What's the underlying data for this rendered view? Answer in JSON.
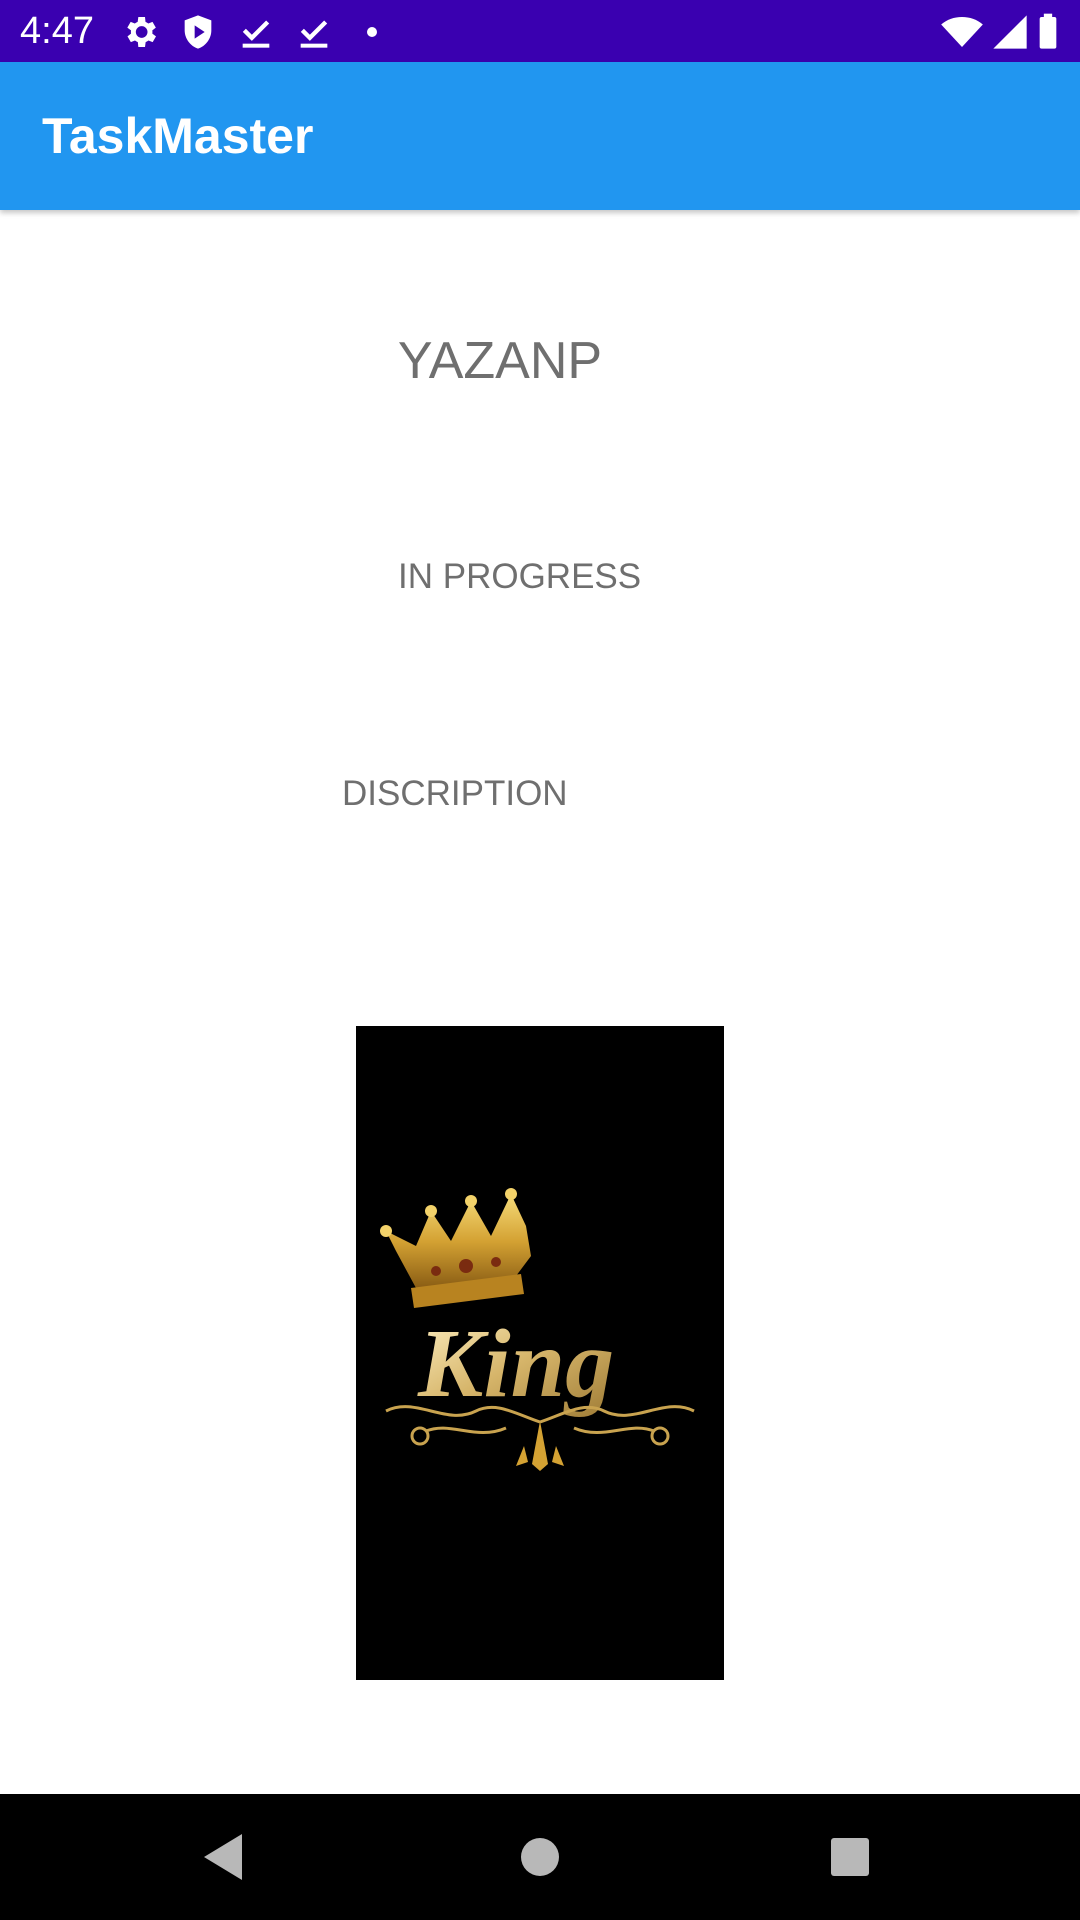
{
  "status_bar": {
    "time": "4:47",
    "icons": [
      "gear-icon",
      "shield-icon",
      "download-done-icon",
      "download-done-icon",
      "dot-icon",
      "wifi-icon",
      "signal-icon",
      "battery-icon"
    ],
    "background": "#3a00b0"
  },
  "app_bar": {
    "title": "TaskMaster",
    "background": "#2196f0"
  },
  "task": {
    "title": "YAZANP",
    "state": "IN PROGRESS",
    "description": "DISCRIPTION",
    "image_logo_text": "King"
  },
  "nav_bar": {
    "icons": [
      "back-icon",
      "home-icon",
      "recents-icon"
    ]
  }
}
